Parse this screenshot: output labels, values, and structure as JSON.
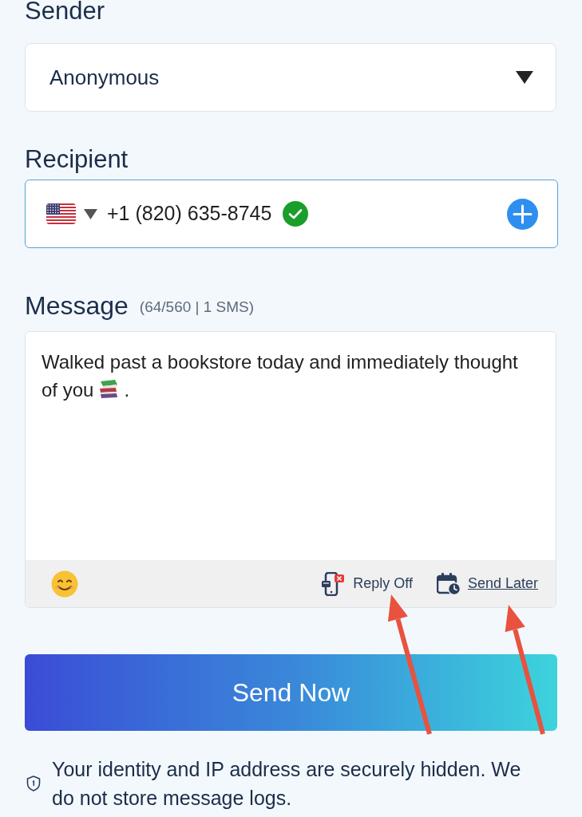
{
  "sender": {
    "label": "Sender",
    "value": "Anonymous"
  },
  "recipient": {
    "label": "Recipient",
    "phone": "+1 (820) 635-8745",
    "verified": true
  },
  "message": {
    "label": "Message",
    "counter": "(64/560 | 1 SMS)",
    "text": "Walked past a bookstore today and immediately thought of you",
    "text_end": "."
  },
  "toolbar": {
    "reply": "Reply Off",
    "schedule": "Send Later"
  },
  "send_button": "Send Now",
  "privacy_note": "Your identity and IP address are securely hidden. We do not store message logs."
}
